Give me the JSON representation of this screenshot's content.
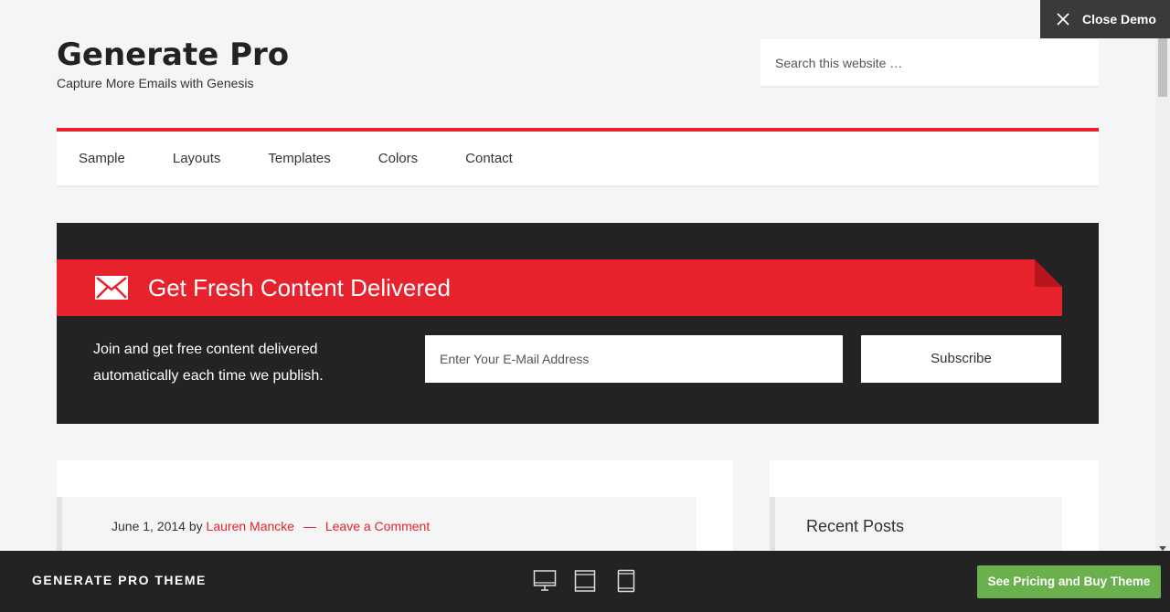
{
  "site": {
    "title": "Generate Pro",
    "description": "Capture More Emails with Genesis"
  },
  "search": {
    "placeholder": "Search this website …"
  },
  "nav": {
    "items": [
      {
        "label": "Sample"
      },
      {
        "label": "Layouts"
      },
      {
        "label": "Templates"
      },
      {
        "label": "Colors"
      },
      {
        "label": "Contact"
      }
    ]
  },
  "optin": {
    "title": "Get Fresh Content Delivered",
    "text": "Join and get free content delivered automatically each time we publish.",
    "email_placeholder": "Enter Your E-Mail Address",
    "subscribe_label": "Subscribe"
  },
  "post": {
    "date": "June 1, 2014",
    "by": "by",
    "author": "Lauren Mancke",
    "separator": "—",
    "comment_link": "Leave a Comment"
  },
  "sidebar": {
    "widget_title": "Recent Posts"
  },
  "demo": {
    "close_label": "Close Demo",
    "theme_name": "GENERATE PRO THEME",
    "buy_label": "See Pricing and Buy Theme",
    "devices": [
      "desktop-icon",
      "tablet-landscape-icon",
      "tablet-portrait-icon"
    ]
  },
  "colors": {
    "accent": "#e8222d",
    "dark": "#232323",
    "buy_green": "#6ab04c"
  }
}
